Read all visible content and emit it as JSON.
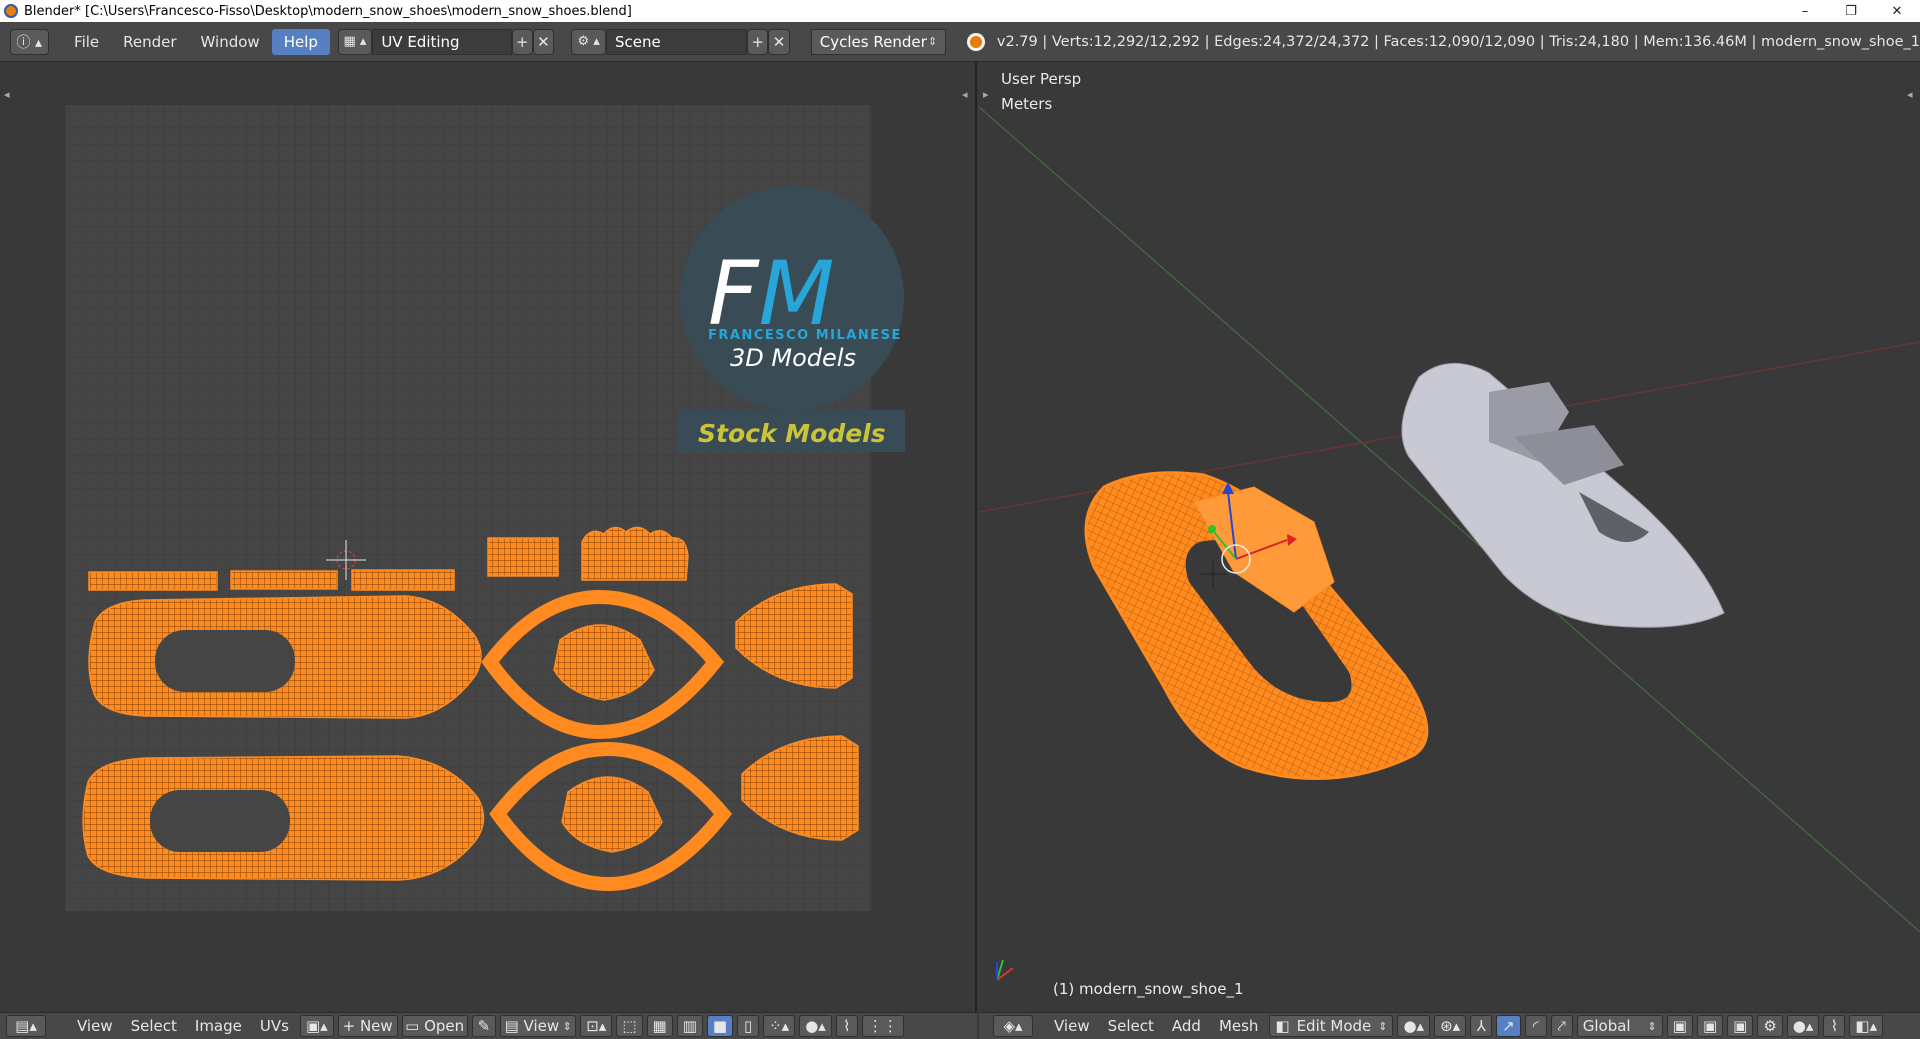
{
  "window": {
    "title": "Blender* [C:\\Users\\Francesco-Fisso\\Desktop\\modern_snow_shoes\\modern_snow_shoes.blend]",
    "controls": [
      "–",
      "❐",
      "✕"
    ]
  },
  "info_header": {
    "menus": [
      "File",
      "Render",
      "Window",
      "Help"
    ],
    "active_menu": "Help",
    "screen_layout": "UV Editing",
    "scene": "Scene",
    "engine": "Cycles Render",
    "stats": "v2.79 | Verts:12,292/12,292 | Edges:24,372/24,372 | Faces:12,090/12,090 | Tris:24,180 | Mem:136.46M | modern_snow_shoe_1"
  },
  "watermark": {
    "logo_letters": "FM",
    "brand": "FRANCESCO MILANESE",
    "subtitle": "3D Models",
    "banner": "Stock Models"
  },
  "viewport": {
    "view_name": "User Persp",
    "units": "Meters",
    "object_label": "(1) modern_snow_shoe_1"
  },
  "uv_footer": {
    "menus": [
      "View",
      "Select",
      "Image",
      "UVs"
    ],
    "new_label": "New",
    "open_label": "Open",
    "view_label": "View"
  },
  "vp_footer": {
    "menus": [
      "View",
      "Select",
      "Add",
      "Mesh"
    ],
    "mode": "Edit Mode",
    "orientation": "Global"
  },
  "colors": {
    "uv_orange": "#ff8a1f",
    "selection_blue": "#5680c2",
    "grid_bg": "#444444",
    "watermark_text": "#c9c43a"
  },
  "icons": [
    "blender-logo-icon",
    "info-editor-icon",
    "screen-layout-icon",
    "scene-icon",
    "add-icon",
    "close-icon",
    "image-editor-icon",
    "3d-view-icon",
    "pin-icon",
    "camera-icon",
    "sphere-shading-icon",
    "manipulator-icon"
  ]
}
